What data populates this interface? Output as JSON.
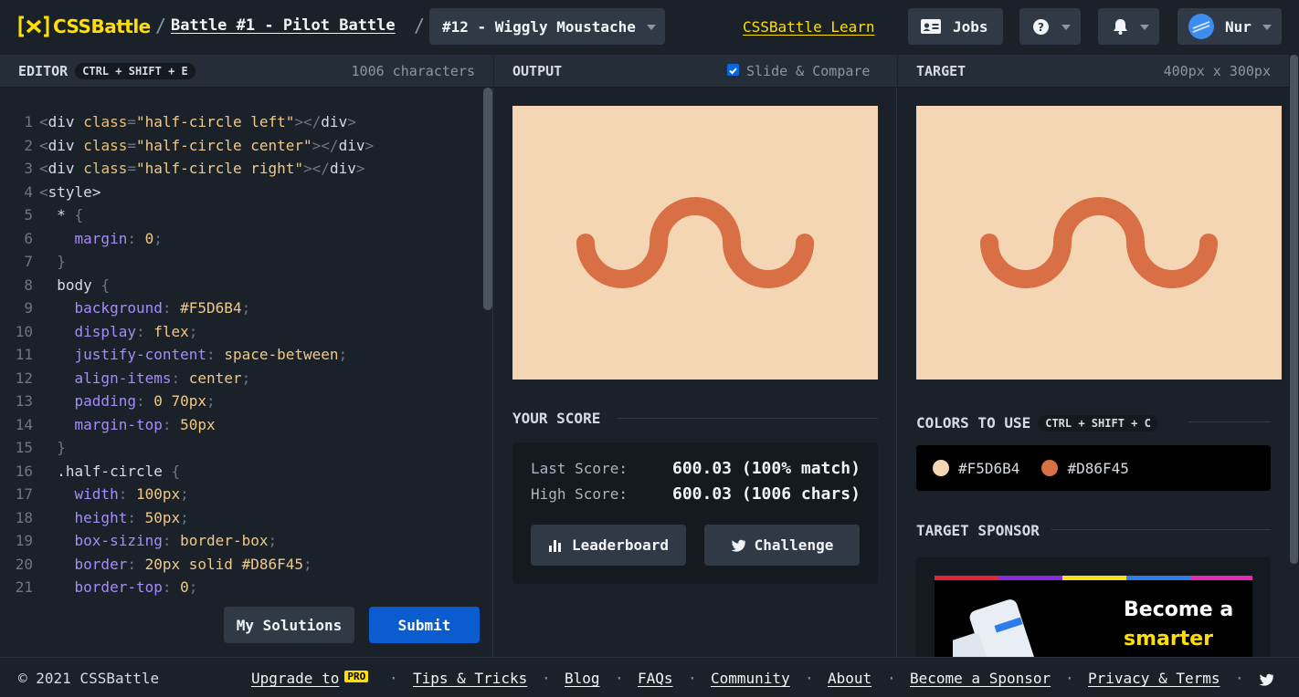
{
  "header": {
    "logo_text": "CSSBattle",
    "battle_link": "Battle #1 - Pilot Battle",
    "target_select": "#12 - Wiggly Moustache",
    "learn_link": "CSSBattle Learn",
    "jobs_label": "Jobs",
    "user_name": "Nur"
  },
  "editor": {
    "title": "EDITOR",
    "shortcut": "CTRL + SHIFT + E",
    "char_count": "1006 characters",
    "my_solutions_label": "My Solutions",
    "submit_label": "Submit"
  },
  "code_lines": [
    "<div class=\"half-circle left\"></div>",
    "<div class=\"half-circle center\"></div>",
    "<div class=\"half-circle right\"></div>",
    "<style>",
    "  * {",
    "    margin: 0;",
    "  }",
    "  body {",
    "    background: #F5D6B4;",
    "    display: flex;",
    "    justify-content: space-between;",
    "    align-items: center;",
    "    padding: 0 70px;",
    "    margin-top: 50px",
    "  }",
    "  .half-circle {",
    "    width: 100px;",
    "    height: 50px;",
    "    box-sizing: border-box;",
    "    border: 20px solid #D86F45;",
    "    border-top: 0;"
  ],
  "output": {
    "title": "OUTPUT",
    "compare_label": "Slide & Compare",
    "compare_checked": true
  },
  "target": {
    "title": "TARGET",
    "size": "400px x 300px"
  },
  "score": {
    "title": "YOUR SCORE",
    "last_label": "Last Score:",
    "last_value": "600.03 (100% match)",
    "high_label": "High Score:",
    "high_value": "600.03 (1006 chars)",
    "leaderboard_label": "Leaderboard",
    "challenge_label": "Challenge"
  },
  "colors": {
    "title": "COLORS TO USE",
    "shortcut": "CTRL + SHIFT + C",
    "items": [
      {
        "hex": "#F5D6B4",
        "label": "#F5D6B4"
      },
      {
        "hex": "#D86F45",
        "label": "#D86F45"
      }
    ]
  },
  "sponsor": {
    "title": "TARGET SPONSOR",
    "ad_line1": "Become a",
    "ad_line2": "smarter"
  },
  "footer": {
    "copyright": "© 2021 CSSBattle",
    "links": [
      "Upgrade to",
      "Tips & Tricks",
      "Blog",
      "FAQs",
      "Community",
      "About",
      "Become a Sponsor",
      "Privacy & Terms"
    ],
    "pro_badge": "PRO"
  }
}
